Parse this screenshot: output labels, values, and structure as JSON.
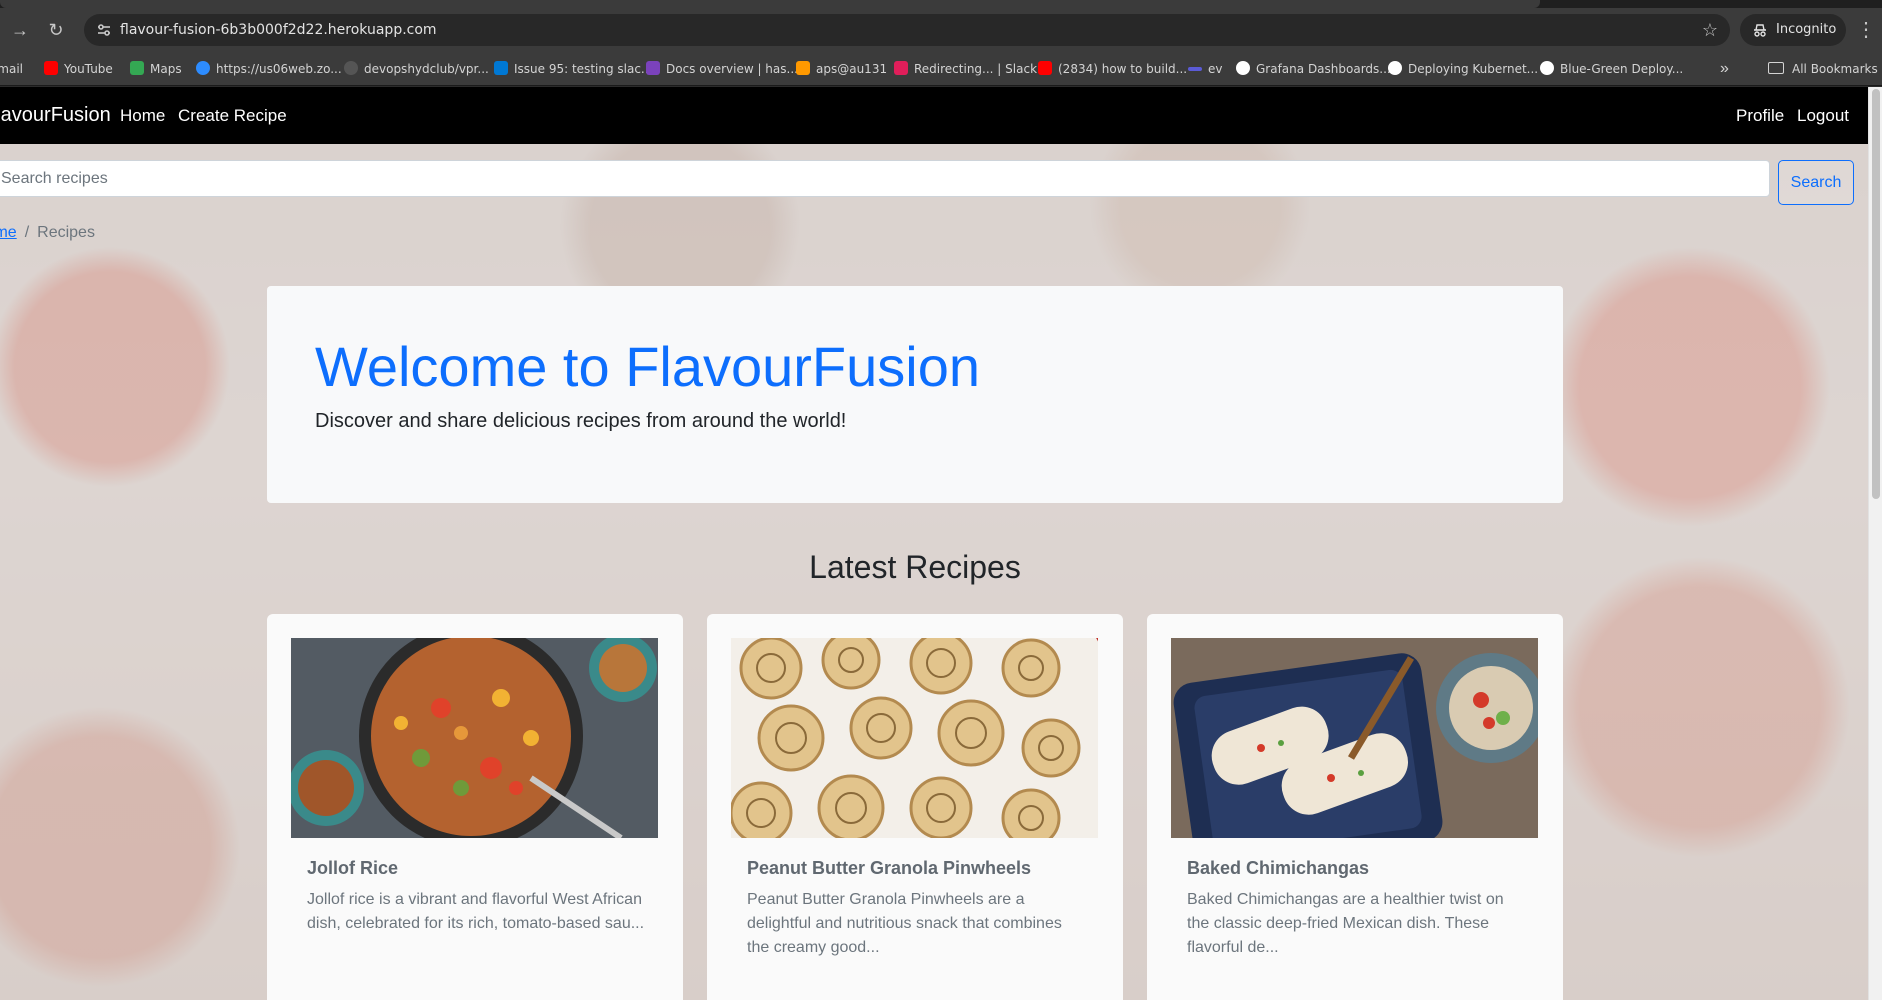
{
  "browser": {
    "url": "flavour-fusion-6b3b000f2d22.herokuapp.com",
    "incognito_label": "Incognito",
    "bookmarks": [
      {
        "label": "Gmail",
        "icon": "gmail-icon",
        "color": "#ea4335"
      },
      {
        "label": "YouTube",
        "icon": "youtube-icon",
        "color": "#ff0000"
      },
      {
        "label": "Maps",
        "icon": "maps-icon",
        "color": "#34a853"
      },
      {
        "label": "https://us06web.zo...",
        "icon": "zoom-icon",
        "color": "#2d8cff"
      },
      {
        "label": "devopshydclub/vpr...",
        "icon": "github-icon",
        "color": "#6e6e6e"
      },
      {
        "label": "Issue 95: testing slac...",
        "icon": "azure-devops-icon",
        "color": "#0078d4"
      },
      {
        "label": "Docs overview | has...",
        "icon": "terraform-icon",
        "color": "#7b42bc"
      },
      {
        "label": "aps@au131",
        "icon": "aws-icon",
        "color": "#ff9900"
      },
      {
        "label": "Redirecting... | Slack",
        "icon": "slack-icon",
        "color": "#e01e5a"
      },
      {
        "label": "(2834) how to build...",
        "icon": "youtube-icon",
        "color": "#ff0000"
      },
      {
        "label": "ev",
        "icon": "bookmark-icon",
        "color": "#5b5bd6"
      },
      {
        "label": "Grafana Dashboards...",
        "icon": "medium-icon",
        "color": "#ffffff"
      },
      {
        "label": "Deploying Kubernet...",
        "icon": "medium-icon",
        "color": "#ffffff"
      },
      {
        "label": "Blue-Green Deploy...",
        "icon": "medium-icon",
        "color": "#ffffff"
      }
    ],
    "all_bookmarks_label": "All Bookmarks"
  },
  "app": {
    "brand": "FlavourFusion",
    "nav": {
      "home": "Home",
      "create_recipe": "Create Recipe",
      "profile": "Profile",
      "logout": "Logout"
    },
    "search": {
      "placeholder": "Search recipes",
      "button_label": "Search"
    },
    "breadcrumb": {
      "home": "Home",
      "current": "Recipes"
    },
    "hero": {
      "title": "Welcome to FlavourFusion",
      "subtitle": "Discover and share delicious recipes from around the world!"
    },
    "section_title": "Latest Recipes",
    "recipes": [
      {
        "title": "Jollof Rice",
        "description": "Jollof rice is a vibrant and flavorful West African dish, celebrated for its rich, tomato-based sau..."
      },
      {
        "title": "Peanut Butter Granola Pinwheels",
        "description": "Peanut Butter Granola Pinwheels are a delightful and nutritious snack that combines the creamy good..."
      },
      {
        "title": "Baked Chimichangas",
        "description": "Baked Chimichangas are a healthier twist on the classic deep-fried Mexican dish. These flavorful de..."
      }
    ]
  },
  "colors": {
    "primary": "#0d6efd",
    "navbar": "#000000",
    "card_button": "#5bc0b8"
  }
}
